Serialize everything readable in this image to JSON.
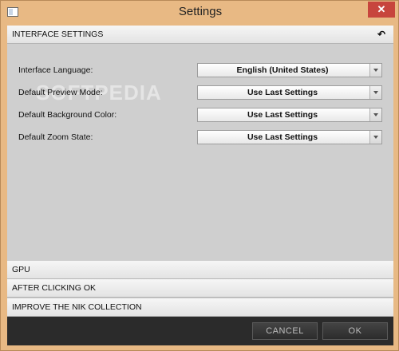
{
  "window": {
    "title": "Settings",
    "close_glyph": "✕"
  },
  "sections": {
    "interface": {
      "label": "INTERFACE SETTINGS",
      "undo_icon": "↶"
    },
    "gpu": {
      "label": "GPU"
    },
    "after_ok": {
      "label": "AFTER CLICKING OK"
    },
    "improve": {
      "label": "IMPROVE THE NIK COLLECTION"
    }
  },
  "settings": [
    {
      "label": "Interface Language:",
      "value": "English (United States)"
    },
    {
      "label": "Default Preview Mode:",
      "value": "Use Last Settings"
    },
    {
      "label": "Default Background Color:",
      "value": "Use Last Settings"
    },
    {
      "label": "Default Zoom State:",
      "value": "Use Last Settings"
    }
  ],
  "watermark": "SOFTPEDIA",
  "footer": {
    "cancel_label": "CANCEL",
    "ok_label": "OK"
  },
  "colors": {
    "accent_border": "#e8b984",
    "close": "#c7453d",
    "panel": "#cfcfcf",
    "footer": "#2b2b2b"
  }
}
